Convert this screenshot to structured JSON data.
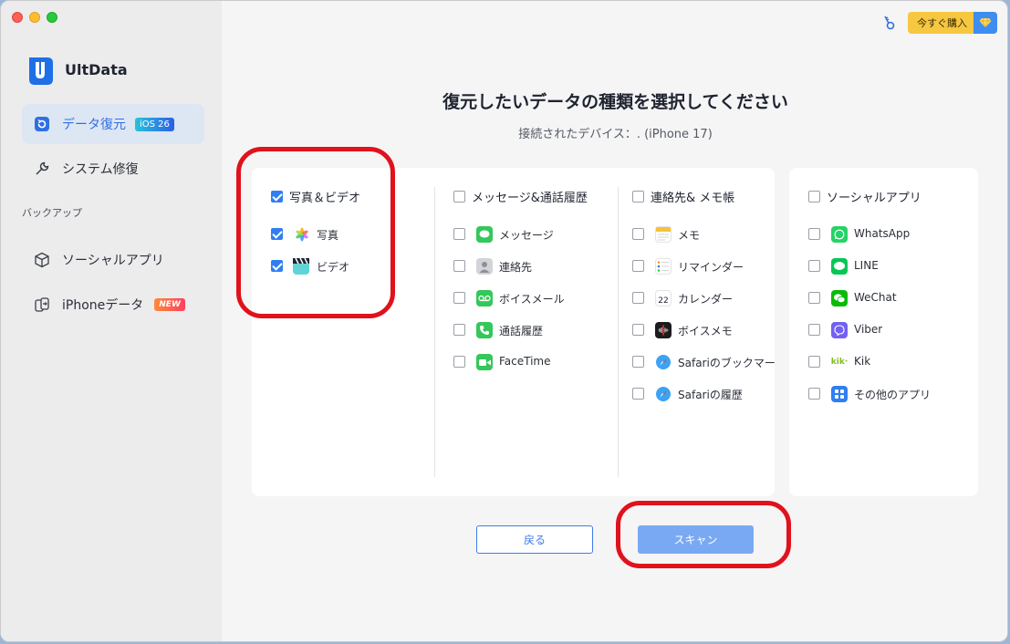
{
  "app": {
    "brand": "UltData"
  },
  "topbar": {
    "buy_label": "今すぐ購入"
  },
  "sidebar": {
    "items": [
      {
        "label": "データ復元",
        "badge": "iOS 26"
      },
      {
        "label": "システム修復"
      }
    ],
    "section_label": "バックアップ",
    "backup_items": [
      {
        "label": "ソーシャルアプリ"
      },
      {
        "label": "iPhoneデータ",
        "badge": "NEW"
      }
    ]
  },
  "main": {
    "title": "復元したいデータの種類を選択してください",
    "subtitle": "接続されたデバイス：. (iPhone 17)",
    "categories": [
      {
        "label": "写真＆ビデオ",
        "checked": true,
        "items": [
          {
            "label": "写真",
            "checked": true,
            "icon": "photos-icon"
          },
          {
            "label": "ビデオ",
            "checked": true,
            "icon": "video-clapper-icon"
          }
        ]
      },
      {
        "label": "メッセージ&通話履歴",
        "checked": false,
        "items": [
          {
            "label": "メッセージ",
            "checked": false,
            "icon": "messages-icon"
          },
          {
            "label": "連絡先",
            "checked": false,
            "icon": "contacts-icon"
          },
          {
            "label": "ボイスメール",
            "checked": false,
            "icon": "voicemail-icon"
          },
          {
            "label": "通話履歴",
            "checked": false,
            "icon": "phone-icon"
          },
          {
            "label": "FaceTime",
            "checked": false,
            "icon": "facetime-icon"
          }
        ]
      },
      {
        "label": "連絡先& メモ帳",
        "checked": false,
        "items": [
          {
            "label": "メモ",
            "checked": false,
            "icon": "notes-icon"
          },
          {
            "label": "リマインダー",
            "checked": false,
            "icon": "reminders-icon"
          },
          {
            "label": "カレンダー",
            "checked": false,
            "icon": "calendar-icon",
            "icon_text": "22"
          },
          {
            "label": "ボイスメモ",
            "checked": false,
            "icon": "voice-memo-icon"
          },
          {
            "label": "Safariのブックマーク",
            "checked": false,
            "icon": "safari-icon"
          },
          {
            "label": "Safariの履歴",
            "checked": false,
            "icon": "safari-icon"
          }
        ]
      },
      {
        "label": "ソーシャルアプリ",
        "checked": false,
        "items": [
          {
            "label": "WhatsApp",
            "checked": false,
            "icon": "whatsapp-icon"
          },
          {
            "label": "LINE",
            "checked": false,
            "icon": "line-icon"
          },
          {
            "label": "WeChat",
            "checked": false,
            "icon": "wechat-icon"
          },
          {
            "label": "Viber",
            "checked": false,
            "icon": "viber-icon"
          },
          {
            "label": "Kik",
            "checked": false,
            "icon": "kik-icon",
            "icon_text": "kik·"
          },
          {
            "label": "その他のアプリ",
            "checked": false,
            "icon": "other-apps-icon"
          }
        ]
      }
    ],
    "back_label": "戻る",
    "scan_label": "スキャン"
  },
  "colors": {
    "accent": "#2f7ff2",
    "highlight_ring": "#e0121b",
    "buy": "#f6c741"
  }
}
